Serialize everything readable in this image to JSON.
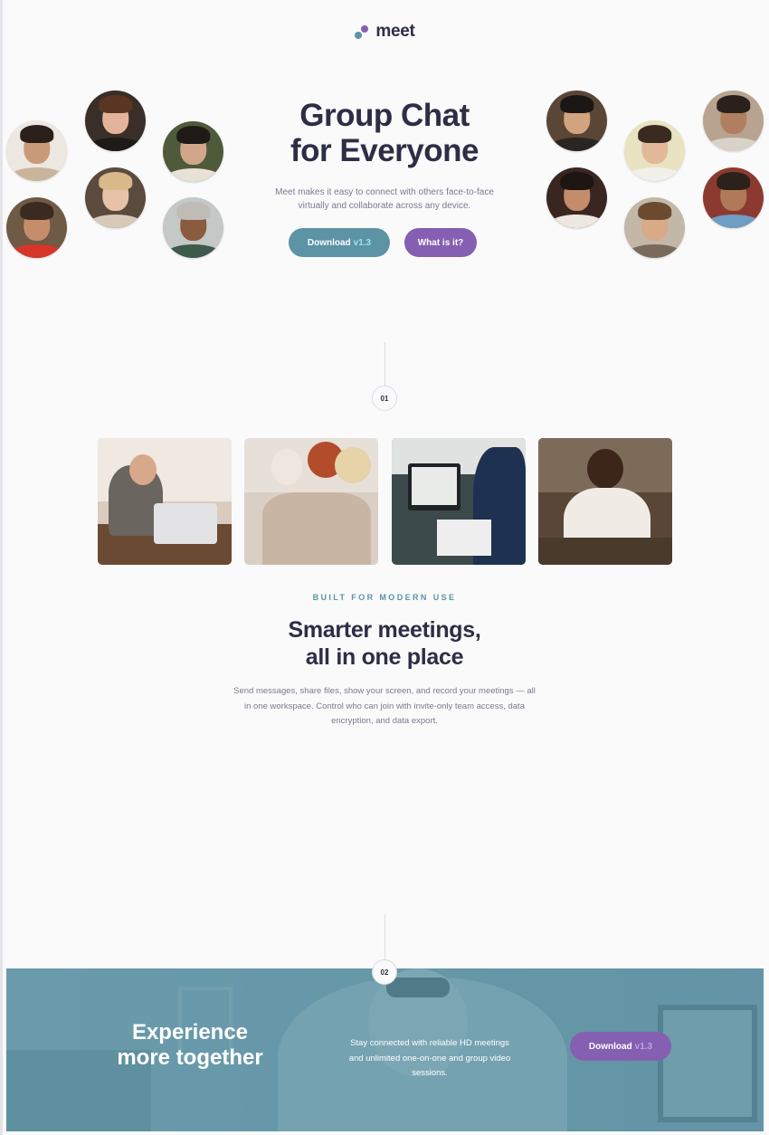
{
  "brand": {
    "name": "meet",
    "colors": {
      "teal": "#5c93a5",
      "purple": "#855fb1",
      "navy": "#2d2e46"
    }
  },
  "hero": {
    "title_line1": "Group Chat",
    "title_line2": "for Everyone",
    "description": "Meet makes it easy to connect with others face-to-face virtually and collaborate across any device.",
    "download_label": "Download",
    "download_version": "v1.3",
    "what_label": "What is it?"
  },
  "section1": {
    "number": "01",
    "eyebrow": "BUILT FOR MODERN USE",
    "title_line1": "Smarter meetings,",
    "title_line2": "all in one place",
    "description": "Send messages, share files, show your screen, and record your meetings — all in one workspace. Control who can join with invite-only team access, data encryption, and data export."
  },
  "section2": {
    "number": "02",
    "title_line1": "Experience",
    "title_line2": "more together",
    "description": "Stay connected with reliable HD meetings and unlimited one-on-one and group video sessions.",
    "download_label": "Download",
    "download_version": "v1.3"
  }
}
